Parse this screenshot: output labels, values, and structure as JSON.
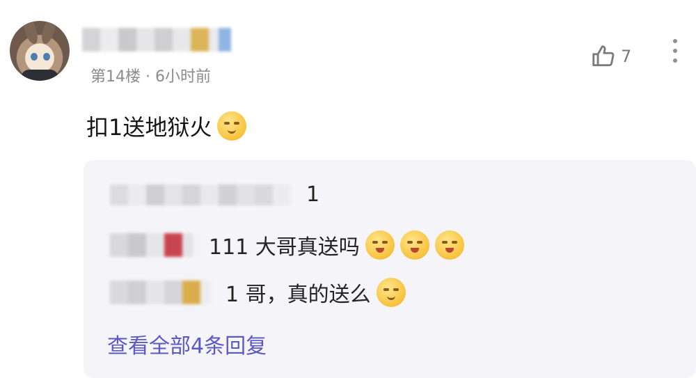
{
  "comment": {
    "floor_time": "第14楼 · 6小时前",
    "like_count": "7",
    "text": "扣1送地狱火"
  },
  "icons": {
    "avatar": "anime-avatar",
    "like": "thumbs-up-icon",
    "more": "more-vertical-icon",
    "emoji_hug": "hug-emoji",
    "emoji_surprised": "surprised-emoji",
    "emoji_smile": "smile-emoji"
  },
  "replies": [
    {
      "text": "1"
    },
    {
      "text": "111 大哥真送吗"
    },
    {
      "text": "1 哥，真的送么"
    }
  ],
  "view_all_label": "查看全部4条回复",
  "colors": {
    "link": "#5b57c7",
    "reply_bg": "#f5f5f9",
    "meta": "#8b8b8f"
  }
}
